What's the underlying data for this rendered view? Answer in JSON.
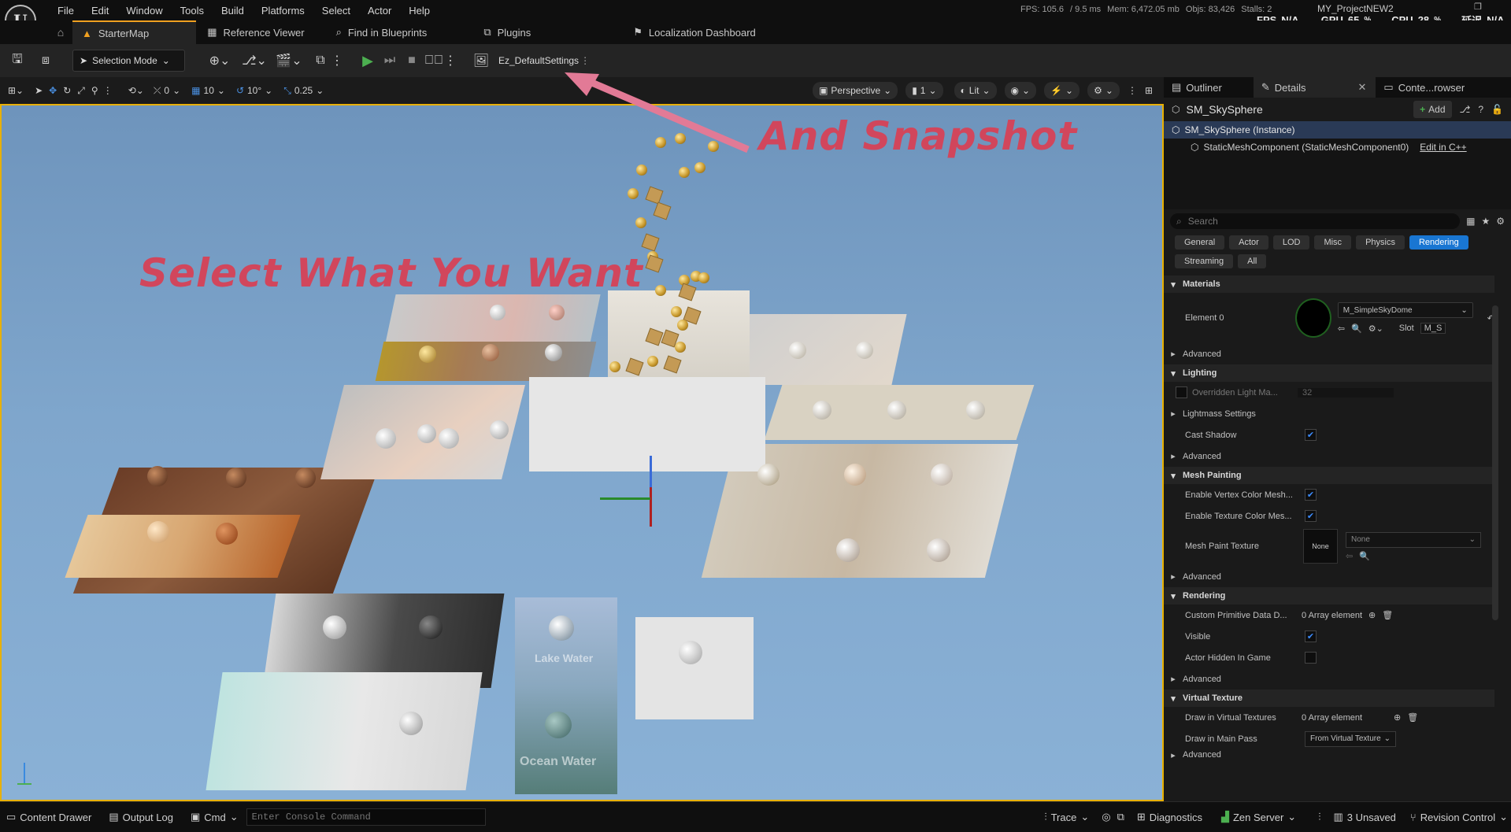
{
  "menu": {
    "items": [
      "File",
      "Edit",
      "Window",
      "Tools",
      "Build",
      "Platforms",
      "Select",
      "Actor",
      "Help"
    ]
  },
  "stats": {
    "fps_line": "FPS: 105.6",
    "ms": "/ 9.5 ms",
    "mem": "Mem: 6,472.05 mb",
    "objs": "Objs: 83,426",
    "stalls": "Stalls: 2",
    "project": "MY_ProjectNEW2",
    "fps_label": "FPS",
    "fps_value": "N/A",
    "gpu_label": "GPU",
    "gpu_value": "65",
    "cpu_label": "CPU",
    "cpu_value": "28",
    "pct": "%",
    "lang": "延迟",
    "na": "N/A"
  },
  "tabs": {
    "starter_map": "StarterMap",
    "reference_viewer": "Reference Viewer",
    "find_in_blueprints": "Find in Blueprints",
    "plugins": "Plugins",
    "localization_dashboard": "Localization Dashboard"
  },
  "toolbar": {
    "selection_mode": "Selection Mode",
    "ez_settings": "Ez_DefaultSettings"
  },
  "viewport_bar": {
    "rotate_val": "0",
    "grid_val": "10",
    "angle_val": "10°",
    "scale_val": "0.25",
    "perspective": "Perspective",
    "camera_speed": "1",
    "lit": "Lit"
  },
  "annotations": {
    "snapshot": "And Snapshot",
    "select": "Select What You Want"
  },
  "scene_labels": {
    "lake_water": "Lake Water",
    "ocean_water": "Ocean Water"
  },
  "panel": {
    "tabs": {
      "outliner": "Outliner",
      "details": "Details",
      "content": "Conte...rowser"
    },
    "actor_name": "SM_SkySphere",
    "add_label": "Add",
    "tree_instance": "SM_SkySphere (Instance)",
    "tree_component": "StaticMeshComponent (StaticMeshComponent0)",
    "edit_cpp": "Edit in C++",
    "search_placeholder": "Search",
    "filters": [
      "General",
      "Actor",
      "LOD",
      "Misc",
      "Physics",
      "Rendering"
    ],
    "filters2": [
      "Streaming",
      "All"
    ],
    "active_filter": "Rendering",
    "sections": {
      "materials": "Materials",
      "lighting": "Lighting",
      "mesh_painting": "Mesh Painting",
      "rendering": "Rendering",
      "virtual_texture": "Virtual Texture"
    },
    "element0": "Element 0",
    "material_name": "M_SimpleSkyDome",
    "slot_label": "Slot",
    "slot_value": "M_S",
    "advanced": "Advanced",
    "overridden_light": "Overridden Light Ma...",
    "overridden_value": "32",
    "lightmass": "Lightmass Settings",
    "cast_shadow": "Cast Shadow",
    "enable_vertex": "Enable Vertex Color Mesh...",
    "enable_texture": "Enable Texture Color Mes...",
    "mesh_paint_texture": "Mesh Paint Texture",
    "none": "None",
    "none_combo": "None",
    "custom_primitive": "Custom Primitive Data D...",
    "array_element": "0 Array element",
    "visible": "Visible",
    "actor_hidden": "Actor Hidden In Game",
    "draw_vt": "Draw in Virtual Textures",
    "array_element2": "0 Array element",
    "draw_main": "Draw in Main Pass",
    "from_vt": "From Virtual Texture"
  },
  "status": {
    "content_drawer": "Content Drawer",
    "output_log": "Output Log",
    "cmd": "Cmd",
    "console_placeholder": "Enter Console Command",
    "trace": "Trace",
    "diagnostics": "Diagnostics",
    "zen_server": "Zen Server",
    "unsaved": "3 Unsaved",
    "revision": "Revision Control"
  },
  "colors": {
    "accent": "#f0a020",
    "select_blue": "#1976d2",
    "annotation_red": "#d1465c",
    "play_green": "#4caf50"
  }
}
